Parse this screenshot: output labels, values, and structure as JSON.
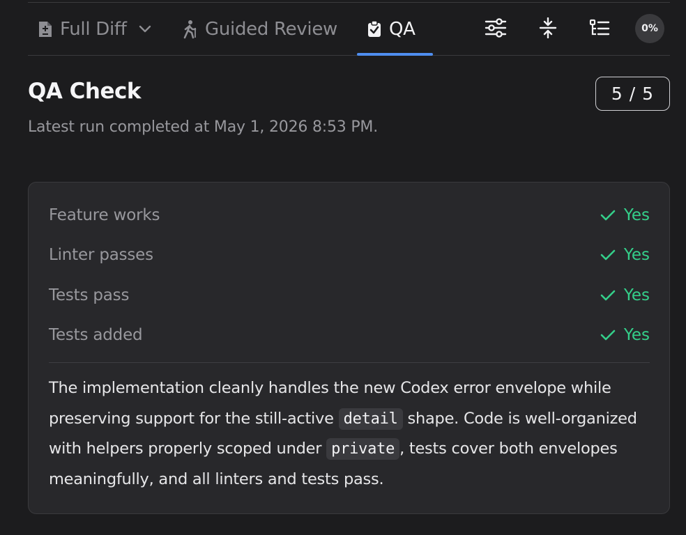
{
  "tabs": [
    {
      "label": "Full Diff",
      "icon": "file-diff-icon",
      "has_dropdown": true
    },
    {
      "label": "Guided Review",
      "icon": "hiker-icon"
    },
    {
      "label": "QA",
      "icon": "clipboard-check-icon",
      "active": true
    }
  ],
  "toolbar": {
    "tools": [
      "sliders-icon",
      "collapse-vertical-icon",
      "tree-list-icon"
    ],
    "progress": "0%"
  },
  "header": {
    "title": "QA Check",
    "subtitle": "Latest run completed at May 1, 2026 8:53 PM.",
    "score": "5 / 5"
  },
  "checks": [
    {
      "label": "Feature works",
      "value": "Yes"
    },
    {
      "label": "Linter passes",
      "value": "Yes"
    },
    {
      "label": "Tests pass",
      "value": "Yes"
    },
    {
      "label": "Tests added",
      "value": "Yes"
    }
  ],
  "summary": {
    "part1": "The implementation cleanly handles the new Codex error envelope while preserving support for the still-active ",
    "code1": "detail",
    "part2": " shape. Code is well-organized with helpers properly scoped under ",
    "code2": "private",
    "part3": ", tests cover both envelopes meaningfully, and all linters and tests pass."
  },
  "colors": {
    "accent": "#4f8ef0",
    "success": "#34d08a",
    "background": "#1c1c1e",
    "card": "#28282b"
  }
}
